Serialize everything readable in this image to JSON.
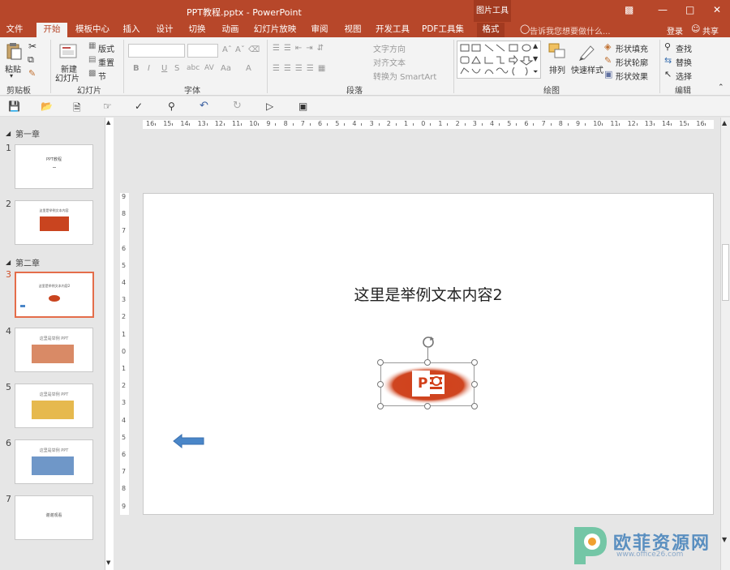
{
  "window": {
    "title": "PPT教程.pptx - PowerPoint",
    "context_tab_group": "图片工具",
    "login": "登录",
    "share": "共享"
  },
  "tabs": [
    "文件",
    "开始",
    "模板中心",
    "插入",
    "设计",
    "切换",
    "动画",
    "幻灯片放映",
    "审阅",
    "视图",
    "开发工具",
    "PDF工具集",
    "格式"
  ],
  "search_placeholder": "告诉我您想要做什么...",
  "ribbon": {
    "clipboard": {
      "paste": "粘贴",
      "group": "剪贴板"
    },
    "slides": {
      "new_slide_1": "新建",
      "new_slide_2": "幻灯片",
      "layout": "版式",
      "reset": "重置",
      "section": "节",
      "group": "幻灯片"
    },
    "font": {
      "group": "字体",
      "bold": "B",
      "italic": "I",
      "underline": "U",
      "strike": "S",
      "shadow": "abc",
      "spacing": "AV",
      "case": "Aa",
      "color": "A"
    },
    "paragraph": {
      "text_direction": "文字方向",
      "align_text": "对齐文本",
      "convert_smartart": "转换为 SmartArt",
      "group": "段落"
    },
    "drawing": {
      "arrange": "排列",
      "quick_styles": "快速样式",
      "shape_fill": "形状填充",
      "shape_outline": "形状轮廓",
      "shape_effects": "形状效果",
      "group": "绘图"
    },
    "editing": {
      "find": "查找",
      "replace": "替换",
      "select": "选择",
      "group": "编辑"
    }
  },
  "sidebar": {
    "sections": [
      "第一章",
      "第二章"
    ],
    "slides": [
      {
        "num": "1",
        "label": "PPT教程"
      },
      {
        "num": "2",
        "label": "这里是举例文本内容"
      },
      {
        "num": "3",
        "label": "这里是举例文本内容2"
      },
      {
        "num": "4",
        "label": "这里是举例 PPT"
      },
      {
        "num": "5",
        "label": "这里是举例 PPT"
      },
      {
        "num": "6",
        "label": "这里是举例 PPT"
      },
      {
        "num": "7",
        "label": "谢谢观看"
      }
    ]
  },
  "ruler": {
    "h_ticks": [
      "16",
      "15",
      "14",
      "13",
      "12",
      "11",
      "10",
      "9",
      "8",
      "7",
      "6",
      "5",
      "4",
      "3",
      "2",
      "1",
      "0",
      "1",
      "2",
      "3",
      "4",
      "5",
      "6",
      "7",
      "8",
      "9",
      "10",
      "11",
      "12",
      "13",
      "14",
      "15",
      "16"
    ],
    "v_ticks": [
      "9",
      "8",
      "7",
      "6",
      "5",
      "4",
      "3",
      "2",
      "1",
      "0",
      "1",
      "2",
      "3",
      "4",
      "5",
      "6",
      "7",
      "8",
      "9"
    ]
  },
  "slide": {
    "text": "这里是举例文本内容2",
    "logo_letter": "P"
  },
  "watermark": {
    "brand": "欧菲资源网",
    "url": "www.office26.com"
  },
  "colors": {
    "accent": "#b7472a",
    "select": "#e46d4a",
    "arrow": "#4a86c8"
  }
}
